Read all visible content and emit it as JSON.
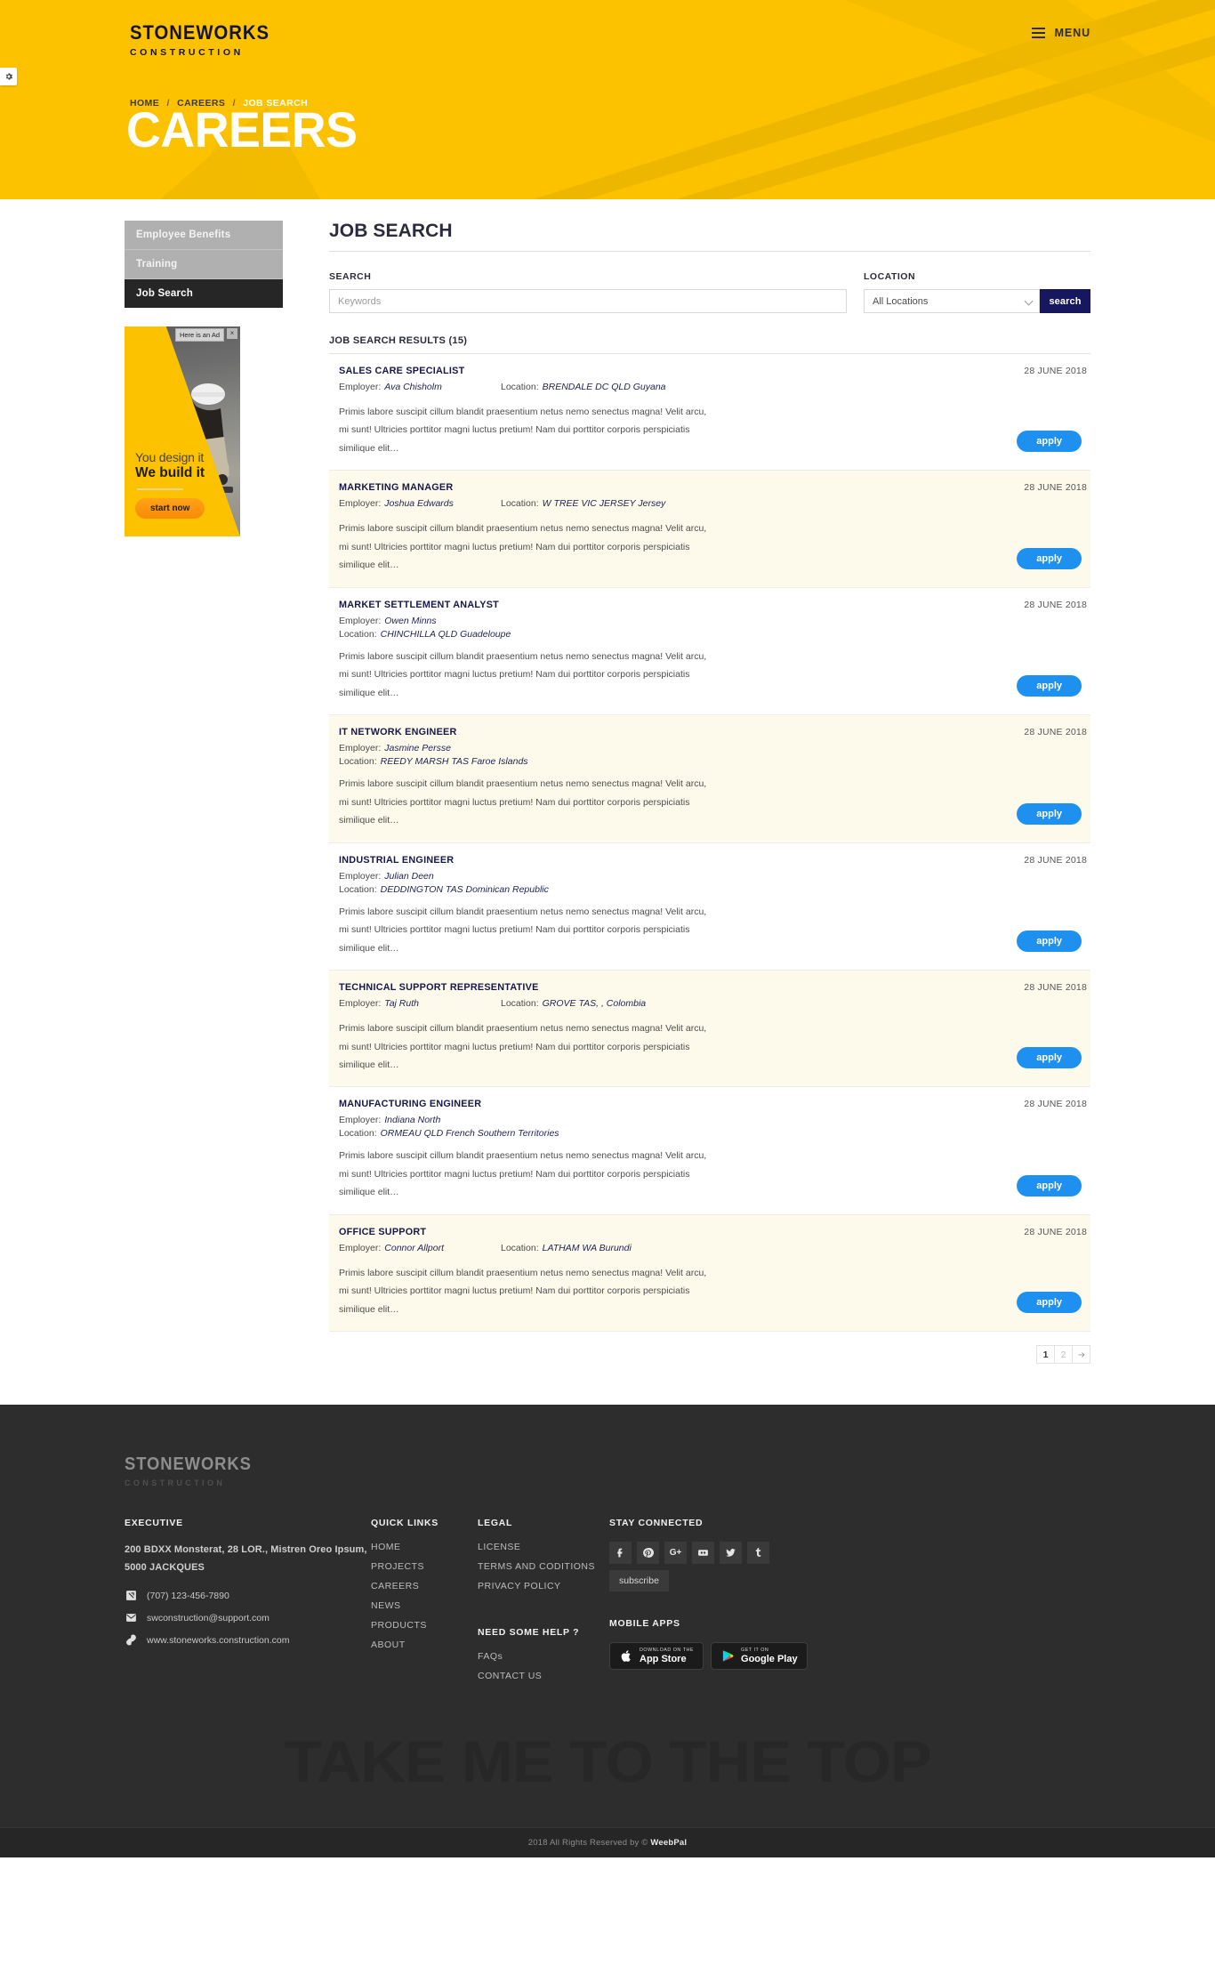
{
  "brand": {
    "name": "STONEWORKS",
    "tagline": "CONSTRUCTION"
  },
  "header": {
    "menu_label": "MENU",
    "gear_icon": "gear-icon",
    "burger_icon": "hamburger-icon"
  },
  "breadcrumb": {
    "home": "HOME",
    "careers": "CAREERS",
    "current": "JOB SEARCH",
    "separator": "/"
  },
  "hero": {
    "title": "CAREERS"
  },
  "sidebar": {
    "items": [
      {
        "label": "Employee Benefits",
        "active": false
      },
      {
        "label": "Training",
        "active": false
      },
      {
        "label": "Job Search",
        "active": true
      }
    ],
    "ad": {
      "tag": "Here is an Ad",
      "close": "×",
      "line1": "You design it",
      "line2": "We build it",
      "button": "start now"
    }
  },
  "main": {
    "section_title": "JOB SEARCH",
    "search": {
      "keywords_label": "SEARCH",
      "keywords_placeholder": "Keywords",
      "keywords_value": "",
      "location_label": "LOCATION",
      "location_value": "All Locations",
      "location_options": [
        "All Locations"
      ],
      "button": "search"
    },
    "results_heading": "JOB SEARCH RESULTS (15)",
    "labels": {
      "employer": "Employer:",
      "location": "Location:",
      "apply": "apply"
    },
    "body_text": "Primis labore suscipit cillum blandit praesentium netus nemo senectus magna! Velit arcu, mi sunt! Ultricies porttitor magni luctus pretium! Nam dui porttitor corporis perspiciatis similique elit…",
    "jobs": [
      {
        "title": "SALES CARE SPECIALIST",
        "date": "28 JUNE 2018",
        "employer": "Ava Chisholm",
        "location": "BRENDALE DC QLD Guyana",
        "inline": true,
        "alt": false
      },
      {
        "title": "MARKETING MANAGER",
        "date": "28 JUNE 2018",
        "employer": "Joshua Edwards",
        "location": "W TREE VIC JERSEY Jersey",
        "inline": true,
        "alt": true
      },
      {
        "title": "MARKET SETTLEMENT ANALYST",
        "date": "28 JUNE 2018",
        "employer": "Owen Minns",
        "location": "CHINCHILLA QLD Guadeloupe",
        "inline": false,
        "alt": false
      },
      {
        "title": "IT NETWORK ENGINEER",
        "date": "28 JUNE 2018",
        "employer": "Jasmine Persse",
        "location": "REEDY MARSH TAS Faroe Islands",
        "inline": false,
        "alt": true
      },
      {
        "title": "INDUSTRIAL ENGINEER",
        "date": "28 JUNE 2018",
        "employer": "Julian Deen",
        "location": "DEDDINGTON TAS Dominican Republic",
        "inline": false,
        "alt": false
      },
      {
        "title": "TECHNICAL SUPPORT REPRESENTATIVE",
        "date": "28 JUNE 2018",
        "employer": "Taj Ruth",
        "location": "GROVE TAS, , Colombia",
        "inline": true,
        "alt": true
      },
      {
        "title": "MANUFACTURING ENGINEER",
        "date": "28 JUNE 2018",
        "employer": "Indiana North",
        "location": "ORMEAU QLD French Southern Territories",
        "inline": false,
        "alt": false
      },
      {
        "title": "OFFICE SUPPORT",
        "date": "28 JUNE 2018",
        "employer": "Connor Allport",
        "location": "LATHAM WA Burundi",
        "inline": true,
        "alt": true
      }
    ],
    "pagination": {
      "pages": [
        "1",
        "2"
      ],
      "active": "1",
      "next_icon": "arrow-right-icon"
    }
  },
  "footer": {
    "executive": {
      "heading": "EXECUTIVE",
      "address": "200 BDXX Monsterat, 28 LOR., Mistren Oreo Ipsum, 5000 JACKQUES",
      "phone": "(707) 123-456-7890",
      "email": "swconstruction@support.com",
      "website": "www.stoneworks.construction.com"
    },
    "quick_links": {
      "heading": "QUICK LINKS",
      "items": [
        "HOME",
        "PROJECTS",
        "CAREERS",
        "NEWS",
        "PRODUCTS",
        "ABOUT"
      ]
    },
    "legal": {
      "heading": "LEGAL",
      "items": [
        "LICENSE",
        "TERMS AND CODITIONS",
        "PRIVACY POLICY"
      ]
    },
    "help": {
      "heading": "NEED SOME HELP ?",
      "items": [
        "FAQs",
        "CONTACT US"
      ]
    },
    "social": {
      "heading": "STAY CONNECTED",
      "icons": [
        "facebook-icon",
        "pinterest-icon",
        "google-plus-icon",
        "flickr-icon",
        "twitter-icon",
        "tumblr-icon"
      ],
      "subscribe": "subscribe"
    },
    "apps": {
      "heading": "MOBILE APPS",
      "appstore_small": "DOWNLOAD ON THE",
      "appstore_big": "App Store",
      "play_small": "GET IT ON",
      "play_big": "Google Play"
    },
    "back_to_top": "TAKE ME TO THE TOP",
    "copyright_pre": "2018 All Rights Reserved by © ",
    "copyright_brand": "WeebPal"
  },
  "colors": {
    "brand_yellow": "#fcc200",
    "navy": "#16175e",
    "apply_blue": "#1e90ef",
    "dark": "#2d2d2d",
    "cream": "#fdfaec"
  }
}
